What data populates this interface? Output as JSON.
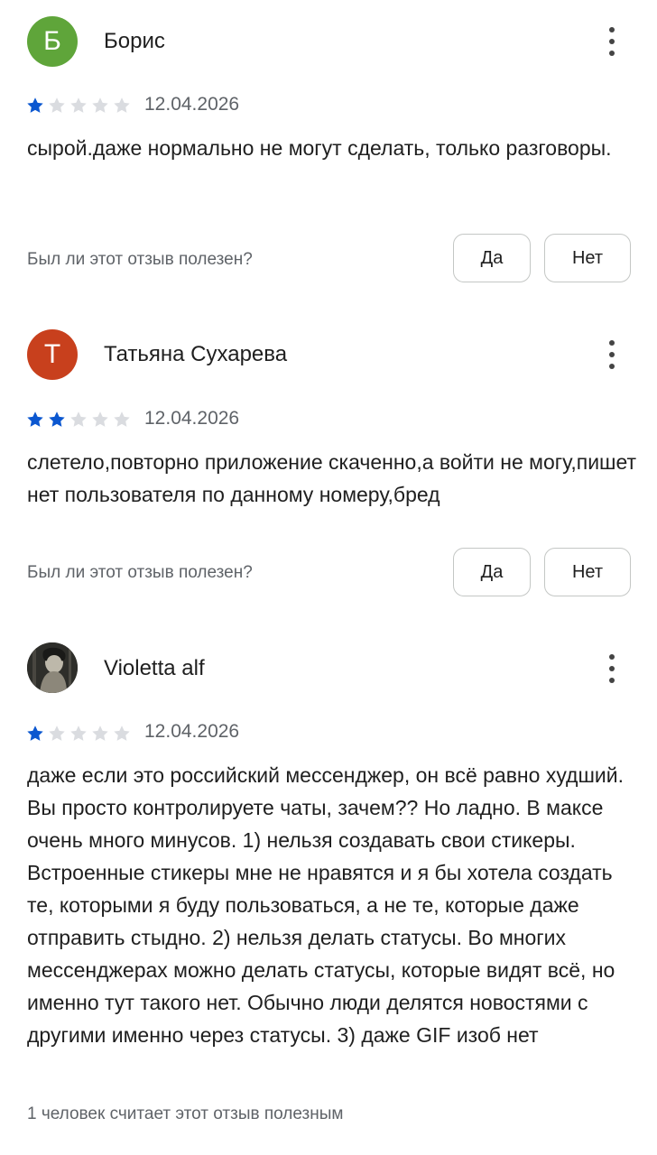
{
  "reviews": [
    {
      "author": "Борис",
      "avatar_letter": "Б",
      "avatar_color": "#5fa53a",
      "rating": 1,
      "date": "12.04.2026",
      "text": "сырой.даже нормально не могут сделать, только разговоры.",
      "helpful_question": "Был ли этот отзыв полезен?",
      "yes_label": "Да",
      "no_label": "Нет"
    },
    {
      "author": "Татьяна Сухарева",
      "avatar_letter": "Т",
      "avatar_color": "#c8401d",
      "rating": 2,
      "date": "12.04.2026",
      "text": "слетело,повторно приложение скаченно,а войти не могу,пишет нет пользователя по данному номеру,бред",
      "helpful_question": "Был ли этот отзыв полезен?",
      "yes_label": "Да",
      "no_label": "Нет"
    },
    {
      "author": "Violetta alf",
      "rating": 1,
      "date": "12.04.2026",
      "text": "даже если это российский мессенджер, он всё равно худший. Вы просто контролируете чаты, зачем?? Но ладно. В максе очень много минусов. 1) нельзя создавать свои стикеры. Встроенные стикеры мне не нравятся и я бы хотела создать те, которыми я буду пользоваться, а не те, которые даже отправить стыдно. 2) нельзя делать статусы. Во многих мессенджерах можно делать статусы, которые видят всё, но именно тут такого нет. Обычно люди делятся новостями с другими именно через статусы. 3) даже GIF изоб нет",
      "helpful_count_text": "1 человек считает этот отзыв полезным"
    }
  ],
  "colors": {
    "star_filled": "#0b57d0",
    "star_empty": "#dadce0"
  }
}
